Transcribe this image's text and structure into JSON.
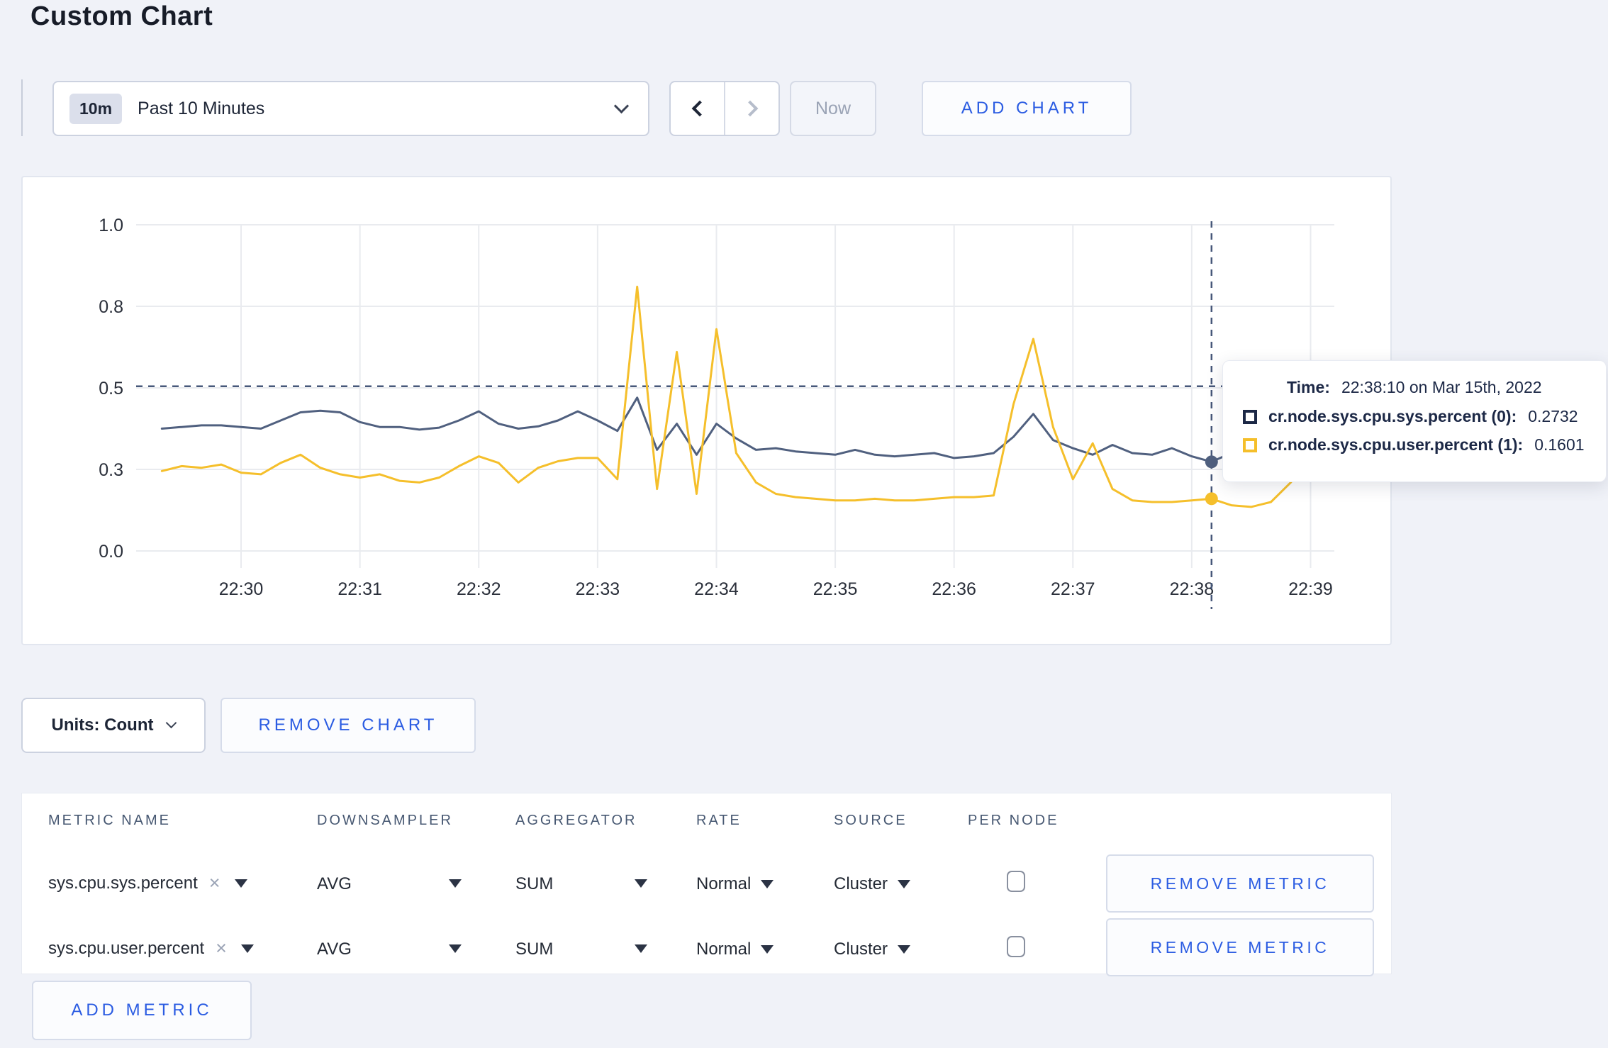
{
  "page": {
    "title": "Custom Chart"
  },
  "icons": {
    "close": "×"
  },
  "controls": {
    "time_window_badge": "10m",
    "time_window_label": "Past 10 Minutes",
    "now_label": "Now",
    "add_chart_label": "ADD CHART"
  },
  "tooltip": {
    "time_label": "Time:",
    "time_value": "22:38:10 on Mar 15th, 2022",
    "series": [
      {
        "label": "cr.node.sys.cpu.sys.percent (0):",
        "value": "0.2732"
      },
      {
        "label": "cr.node.sys.cpu.user.percent (1):",
        "value": "0.1601"
      }
    ]
  },
  "units_row": {
    "units_label": "Units: Count",
    "remove_chart_label": "REMOVE CHART"
  },
  "metrics_table": {
    "headers": [
      "METRIC NAME",
      "DOWNSAMPLER",
      "AGGREGATOR",
      "RATE",
      "SOURCE",
      "PER NODE"
    ],
    "rows": [
      {
        "metric": "sys.cpu.sys.percent",
        "downsampler": "AVG",
        "aggregator": "SUM",
        "rate": "Normal",
        "source": "Cluster",
        "per_node_checked": false,
        "remove_label": "REMOVE METRIC"
      },
      {
        "metric": "sys.cpu.user.percent",
        "downsampler": "AVG",
        "aggregator": "SUM",
        "rate": "Normal",
        "source": "Cluster",
        "per_node_checked": false,
        "remove_label": "REMOVE METRIC"
      }
    ],
    "add_metric_label": "ADD METRIC"
  },
  "chart_data": {
    "type": "line",
    "title": "",
    "xlabel": "",
    "ylabel": "",
    "grid": true,
    "legend_position": "tooltip",
    "ylim": [
      0,
      1
    ],
    "x_domain": [
      "22:29:07",
      "22:39:12"
    ],
    "x_ticks": [
      "22:30",
      "22:31",
      "22:32",
      "22:33",
      "22:34",
      "22:35",
      "22:36",
      "22:37",
      "22:38",
      "22:39"
    ],
    "y_ticks": {
      "values": [
        0,
        0.25,
        0.5,
        0.75,
        1
      ],
      "labels": [
        "0.0",
        "0.3",
        "0.5",
        "0.8",
        "1.0"
      ]
    },
    "times": [
      "22:29:20",
      "22:29:30",
      "22:29:40",
      "22:29:50",
      "22:30:00",
      "22:30:10",
      "22:30:20",
      "22:30:30",
      "22:30:40",
      "22:30:50",
      "22:31:00",
      "22:31:10",
      "22:31:20",
      "22:31:30",
      "22:31:40",
      "22:31:50",
      "22:32:00",
      "22:32:10",
      "22:32:20",
      "22:32:30",
      "22:32:40",
      "22:32:50",
      "22:33:00",
      "22:33:10",
      "22:33:20",
      "22:33:30",
      "22:33:40",
      "22:33:50",
      "22:34:00",
      "22:34:10",
      "22:34:20",
      "22:34:30",
      "22:34:40",
      "22:34:50",
      "22:35:00",
      "22:35:10",
      "22:35:20",
      "22:35:30",
      "22:35:40",
      "22:35:50",
      "22:36:00",
      "22:36:10",
      "22:36:20",
      "22:36:30",
      "22:36:40",
      "22:36:50",
      "22:37:00",
      "22:37:10",
      "22:37:20",
      "22:37:30",
      "22:37:40",
      "22:37:50",
      "22:38:00",
      "22:38:10",
      "22:38:20",
      "22:38:30",
      "22:38:40",
      "22:38:50",
      "22:39:00",
      "22:39:10"
    ],
    "series": [
      {
        "name": "cr.node.sys.cpu.sys.percent (0)",
        "color": "#50607f",
        "values": [
          0.375,
          0.38,
          0.385,
          0.385,
          0.38,
          0.375,
          0.4,
          0.425,
          0.43,
          0.425,
          0.395,
          0.38,
          0.38,
          0.372,
          0.378,
          0.4,
          0.428,
          0.39,
          0.375,
          0.382,
          0.4,
          0.428,
          0.4,
          0.368,
          0.47,
          0.31,
          0.39,
          0.295,
          0.39,
          0.345,
          0.31,
          0.315,
          0.305,
          0.3,
          0.295,
          0.31,
          0.295,
          0.29,
          0.295,
          0.3,
          0.285,
          0.29,
          0.3,
          0.35,
          0.42,
          0.34,
          0.315,
          0.295,
          0.325,
          0.3,
          0.295,
          0.315,
          0.29,
          0.2732,
          0.3,
          0.31,
          0.3,
          0.295,
          0.3,
          0.31
        ]
      },
      {
        "name": "cr.node.sys.cpu.user.percent (1)",
        "color": "#f5bf2b",
        "values": [
          0.245,
          0.26,
          0.255,
          0.265,
          0.24,
          0.235,
          0.27,
          0.295,
          0.255,
          0.235,
          0.225,
          0.235,
          0.215,
          0.21,
          0.225,
          0.26,
          0.29,
          0.27,
          0.21,
          0.255,
          0.275,
          0.285,
          0.285,
          0.22,
          0.81,
          0.19,
          0.61,
          0.175,
          0.68,
          0.3,
          0.21,
          0.175,
          0.165,
          0.16,
          0.155,
          0.155,
          0.16,
          0.155,
          0.155,
          0.16,
          0.165,
          0.165,
          0.17,
          0.45,
          0.65,
          0.38,
          0.22,
          0.33,
          0.19,
          0.155,
          0.15,
          0.15,
          0.155,
          0.1601,
          0.14,
          0.135,
          0.15,
          0.21,
          0.285,
          0.24
        ]
      }
    ],
    "crosshair": {
      "time": "22:38:10",
      "y_value": 0.505
    }
  },
  "colors": {
    "accent_blue": "#2b5ce2",
    "navy": "#1c2846",
    "grid": "#e9ebef",
    "crosshair": "#47587a",
    "axis_text": "#2a2f3a"
  }
}
